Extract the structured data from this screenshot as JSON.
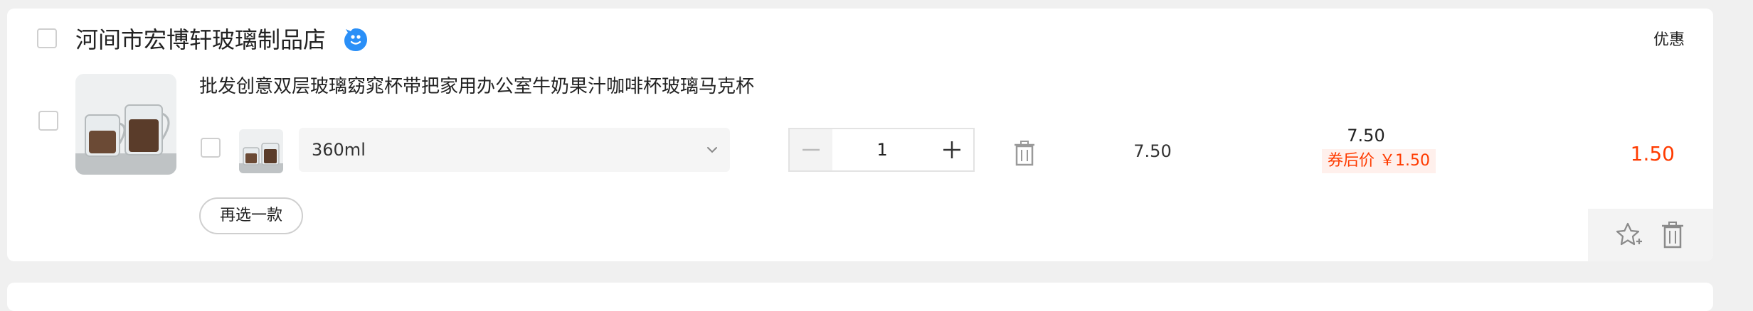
{
  "shop": {
    "name": "河间市宏博轩玻璃制品店",
    "icon": "wangwang-chat-icon",
    "promo_label": "优惠"
  },
  "product": {
    "title": "批发创意双层玻璃窈窕杯带把家用办公室牛奶果汁咖啡杯玻璃马克杯",
    "image": "glass-mug-product-image",
    "sku": {
      "selected": "360ml"
    },
    "quantity": "1",
    "unit_price": "7.50",
    "original_price": "7.50",
    "coupon_price": "券后价 ￥1.50",
    "final_price": "1.50",
    "reselect_label": "再选一款"
  },
  "colors": {
    "accent": "#ff3b00",
    "brand_blue": "#2a8ff7"
  }
}
